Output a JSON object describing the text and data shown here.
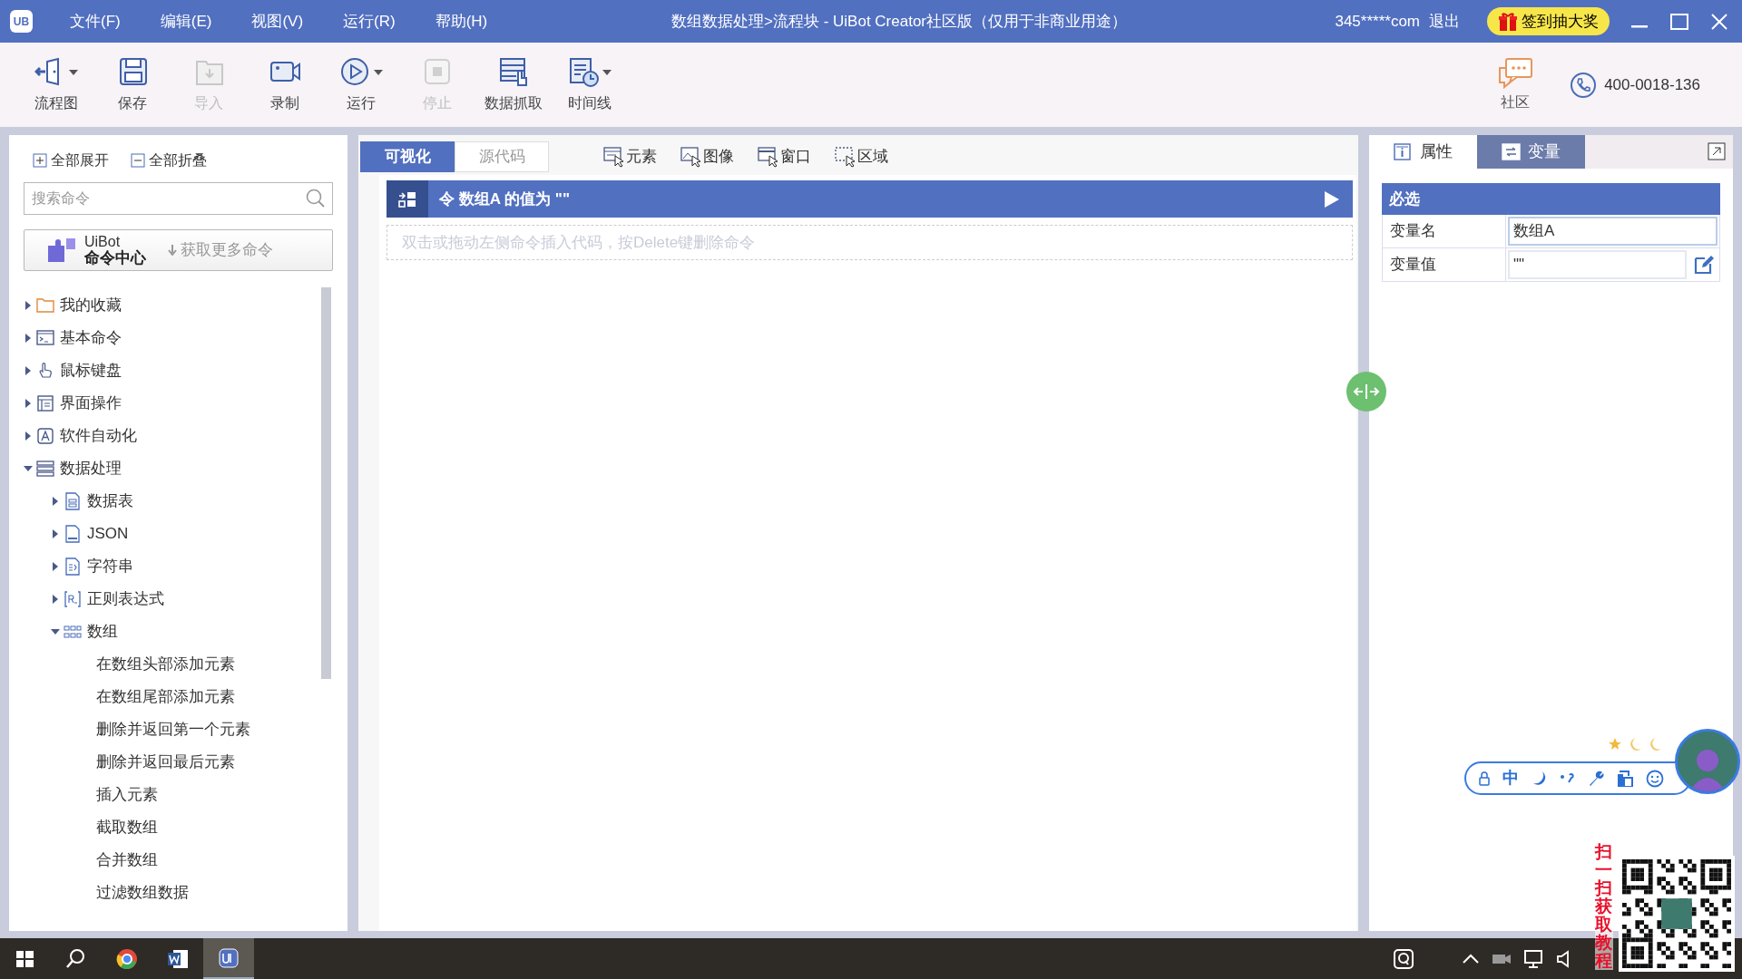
{
  "window": {
    "title": "数组数据处理>流程块 - UiBot Creator社区版（仅用于非商业用途）",
    "logo": "UB",
    "account": "345*****com",
    "logout": "退出",
    "sign_in_button": "签到抽大奖"
  },
  "menu": [
    "文件(F)",
    "编辑(E)",
    "视图(V)",
    "运行(R)",
    "帮助(H)"
  ],
  "toolbar": [
    {
      "kind": "flow",
      "label": "流程图",
      "disabled": false,
      "dropdown": true
    },
    {
      "kind": "save",
      "label": "保存",
      "disabled": false,
      "dropdown": false
    },
    {
      "kind": "import",
      "label": "导入",
      "disabled": true,
      "dropdown": false
    },
    {
      "kind": "record",
      "label": "录制",
      "disabled": false,
      "dropdown": false
    },
    {
      "kind": "run",
      "label": "运行",
      "disabled": false,
      "dropdown": true
    },
    {
      "kind": "stop",
      "label": "停止",
      "disabled": true,
      "dropdown": false
    },
    {
      "kind": "scrape",
      "label": "数据抓取",
      "disabled": false,
      "dropdown": false
    },
    {
      "kind": "timeline",
      "label": "时间线",
      "disabled": false,
      "dropdown": true
    }
  ],
  "toolbar_right": {
    "community": "社区",
    "phone": "400-0018-136"
  },
  "sidebar": {
    "expand_all": "全部展开",
    "collapse_all": "全部折叠",
    "search": {
      "placeholder": "搜索命令"
    },
    "command_center": {
      "brand": "UiBot",
      "title": "命令中心",
      "action": "获取更多命令"
    },
    "tree": [
      {
        "kind": "folder",
        "label": "我的收藏",
        "expanded": false
      },
      {
        "kind": "terminal",
        "label": "基本命令",
        "expanded": false
      },
      {
        "kind": "mouse",
        "label": "鼠标键盘",
        "expanded": false
      },
      {
        "kind": "window",
        "label": "界面操作",
        "expanded": false
      },
      {
        "kind": "app",
        "label": "软件自动化",
        "expanded": false
      },
      {
        "kind": "data",
        "label": "数据处理",
        "expanded": true,
        "children": [
          {
            "kind": "table",
            "label": "数据表",
            "expanded": false
          },
          {
            "kind": "json",
            "label": "JSON",
            "expanded": false
          },
          {
            "kind": "string",
            "label": "字符串",
            "expanded": false
          },
          {
            "kind": "regex",
            "label": "正则表达式",
            "expanded": false
          },
          {
            "kind": "array",
            "label": "数组",
            "expanded": true,
            "children": [
              {
                "label": "在数组头部添加元素"
              },
              {
                "label": "在数组尾部添加元素"
              },
              {
                "label": "删除并返回第一个元素"
              },
              {
                "label": "删除并返回最后元素"
              },
              {
                "label": "插入元素"
              },
              {
                "label": "截取数组"
              },
              {
                "label": "合并数组"
              },
              {
                "label": "过滤数组数据"
              }
            ]
          }
        ]
      }
    ]
  },
  "editor": {
    "tabs": [
      {
        "label": "可视化",
        "selected": true
      },
      {
        "label": "源代码",
        "selected": false
      }
    ],
    "tools": [
      {
        "kind": "element",
        "label": "元素"
      },
      {
        "kind": "image",
        "label": "图像"
      },
      {
        "kind": "window",
        "label": "窗口"
      },
      {
        "kind": "region",
        "label": "区域"
      }
    ],
    "blocks": [
      {
        "text": "令 数组A 的值为 \"\""
      }
    ],
    "hint": "双击或拖动左侧命令插入代码，按Delete键删除命令"
  },
  "properties": {
    "tabs": [
      {
        "kind": "info",
        "label": "属性",
        "selected": true
      },
      {
        "kind": "variable",
        "label": "变量",
        "selected": false
      }
    ],
    "section": "必选",
    "fields": [
      {
        "label": "变量名",
        "value": "数组A",
        "editable": false
      },
      {
        "label": "变量值",
        "value": "\"\"",
        "editable": true
      }
    ]
  },
  "ime": {
    "mode": "中"
  },
  "overlay": {
    "text": "扫一扫获取教程"
  },
  "taskbar": [
    {
      "kind": "start",
      "selected": false
    },
    {
      "kind": "search",
      "selected": false
    },
    {
      "kind": "browser",
      "selected": false
    },
    {
      "kind": "word",
      "selected": false
    },
    {
      "kind": "ub",
      "selected": true
    }
  ]
}
